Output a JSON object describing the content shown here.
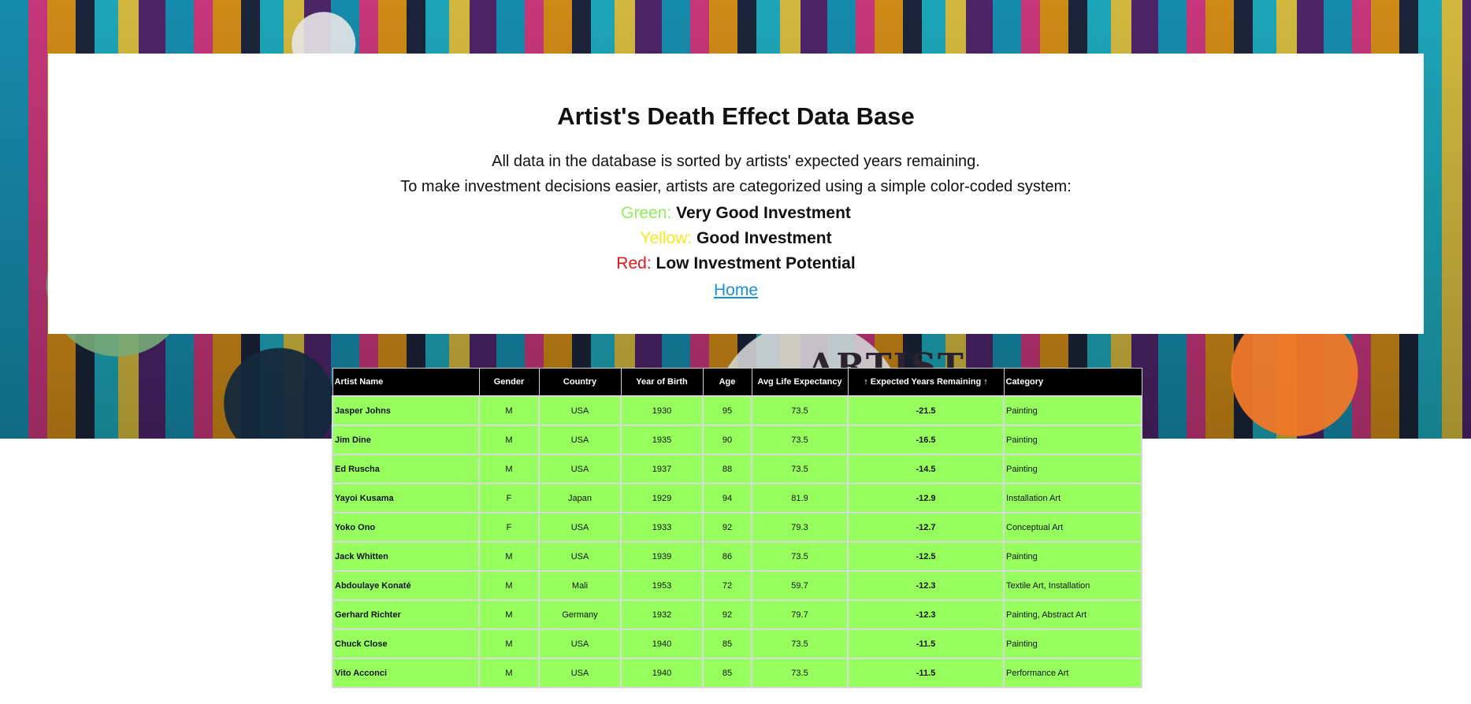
{
  "banner": {
    "word": "ARTIST"
  },
  "header": {
    "title": "Artist's Death Effect Data Base",
    "description_1": "All data in the database is sorted by artists' expected years remaining.",
    "description_2": "To make investment decisions easier, artists are categorized using a simple color-coded system:",
    "legend": [
      {
        "color_label": "Green:",
        "meaning": "Very Good Investment",
        "color": "#90ee5a"
      },
      {
        "color_label": "Yellow:",
        "meaning": "Good Investment",
        "color": "#f4e81d"
      },
      {
        "color_label": "Red:",
        "meaning": "Low Investment Potential",
        "color": "#e8141b"
      }
    ],
    "home_link": "Home"
  },
  "table": {
    "row_color": "#96ff5e",
    "columns": [
      "Artist Name",
      "Gender",
      "Country",
      "Year of Birth",
      "Age",
      "Avg Life Expectancy",
      "↑ Expected Years Remaining ↑",
      "Category"
    ],
    "rows": [
      [
        "Jasper Johns",
        "M",
        "USA",
        "1930",
        "95",
        "73.5",
        "-21.5",
        "Painting"
      ],
      [
        "Jim Dine",
        "M",
        "USA",
        "1935",
        "90",
        "73.5",
        "-16.5",
        "Painting"
      ],
      [
        "Ed Ruscha",
        "M",
        "USA",
        "1937",
        "88",
        "73.5",
        "-14.5",
        "Painting"
      ],
      [
        "Yayoi Kusama",
        "F",
        "Japan",
        "1929",
        "94",
        "81.9",
        "-12.9",
        "Installation Art"
      ],
      [
        "Yoko Ono",
        "F",
        "USA",
        "1933",
        "92",
        "79.3",
        "-12.7",
        "Conceptual Art"
      ],
      [
        "Jack Whitten",
        "M",
        "USA",
        "1939",
        "86",
        "73.5",
        "-12.5",
        "Painting"
      ],
      [
        "Abdoulaye Konaté",
        "M",
        "Mali",
        "1953",
        "72",
        "59.7",
        "-12.3",
        "Textile Art, Installation"
      ],
      [
        "Gerhard Richter",
        "M",
        "Germany",
        "1932",
        "92",
        "79.7",
        "-12.3",
        "Painting, Abstract Art"
      ],
      [
        "Chuck Close",
        "M",
        "USA",
        "1940",
        "85",
        "73.5",
        "-11.5",
        "Painting"
      ],
      [
        "Vito Acconci",
        "M",
        "USA",
        "1940",
        "85",
        "73.5",
        "-11.5",
        "Performance Art"
      ]
    ]
  }
}
